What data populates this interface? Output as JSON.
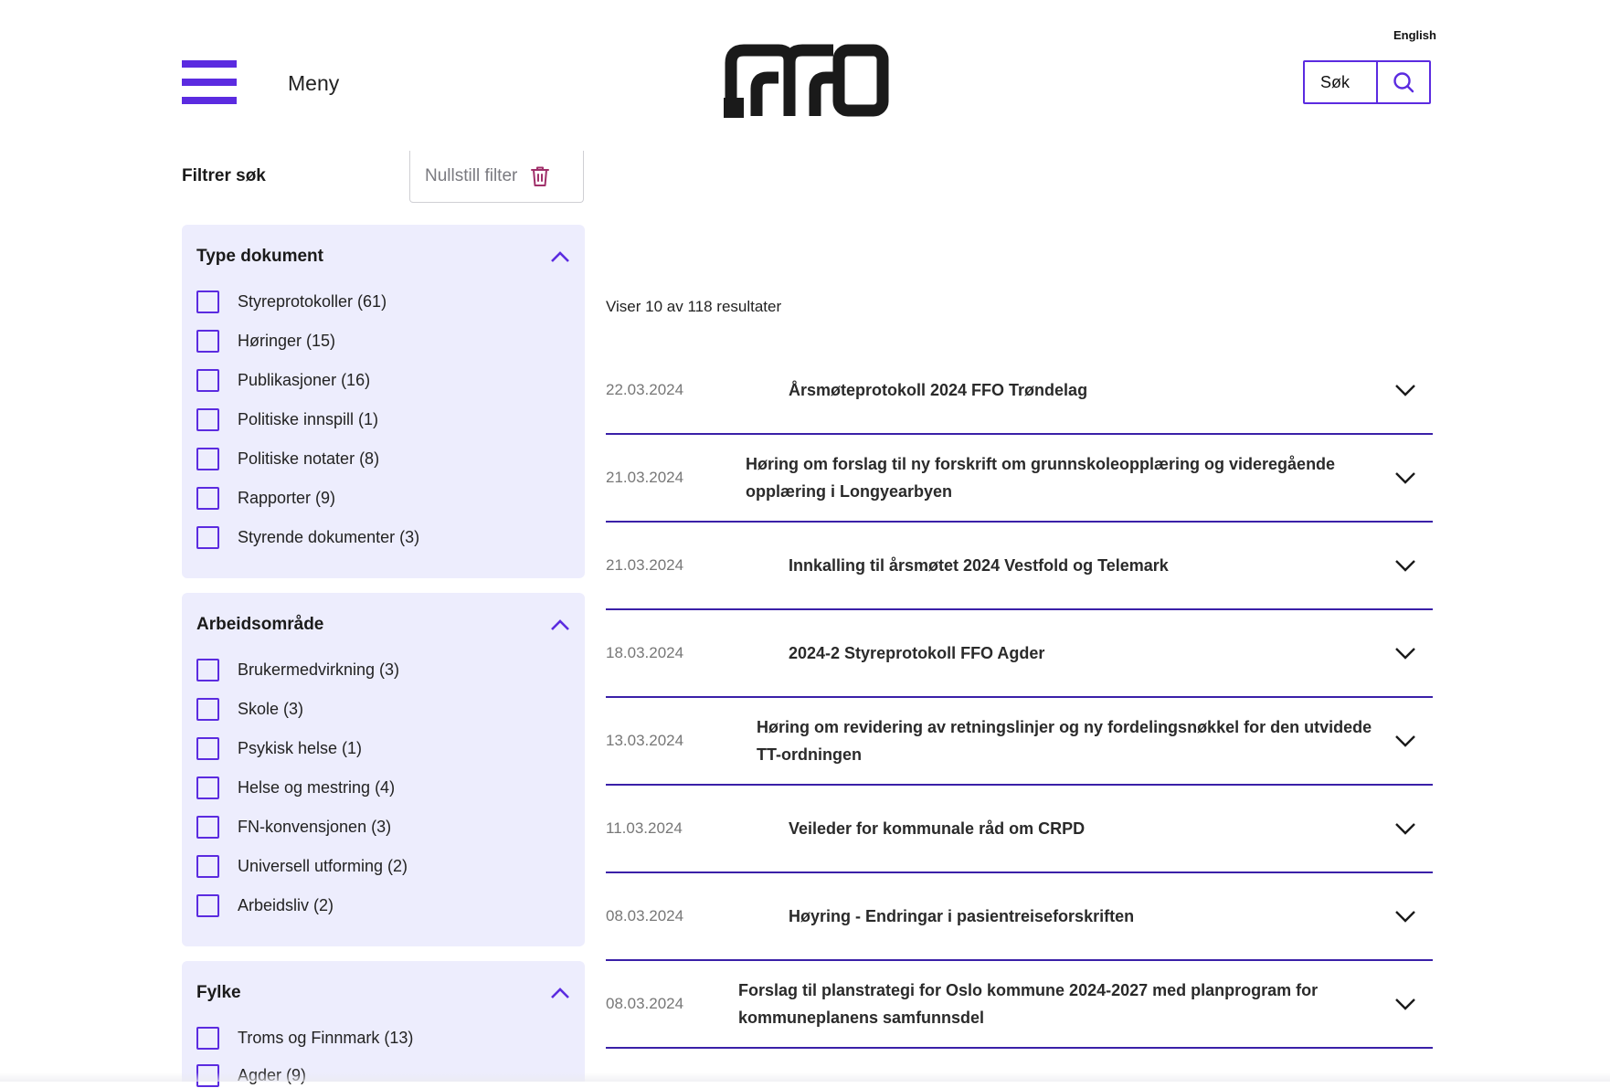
{
  "header": {
    "menu_label": "Meny",
    "logo_text": "FFO",
    "language_link": "English",
    "search_placeholder": "Søk",
    "accent_color": "#5b2be0"
  },
  "filters": {
    "title": "Filtrer søk",
    "reset_label": "Nullstill filter",
    "groups": [
      {
        "title": "Type dokument",
        "expanded": true,
        "options": [
          {
            "label": "Styreprotokoller (61)",
            "checked": false
          },
          {
            "label": "Høringer (15)",
            "checked": false
          },
          {
            "label": "Publikasjoner (16)",
            "checked": false
          },
          {
            "label": "Politiske innspill (1)",
            "checked": false
          },
          {
            "label": "Politiske notater (8)",
            "checked": false
          },
          {
            "label": "Rapporter (9)",
            "checked": false
          },
          {
            "label": "Styrende dokumenter (3)",
            "checked": false
          }
        ]
      },
      {
        "title": "Arbeidsområde",
        "expanded": true,
        "options": [
          {
            "label": "Brukermedvirkning (3)",
            "checked": false
          },
          {
            "label": "Skole (3)",
            "checked": false
          },
          {
            "label": "Psykisk helse (1)",
            "checked": false
          },
          {
            "label": "Helse og mestring (4)",
            "checked": false
          },
          {
            "label": "FN-konvensjonen (3)",
            "checked": false
          },
          {
            "label": "Universell utforming (2)",
            "checked": false
          },
          {
            "label": "Arbeidsliv (2)",
            "checked": false
          }
        ]
      },
      {
        "title": "Fylke",
        "expanded": true,
        "options": [
          {
            "label": "Troms og Finnmark (13)",
            "checked": false
          },
          {
            "label": "Agder (9)",
            "checked": false
          }
        ]
      }
    ]
  },
  "results": {
    "count_text": "Viser 10 av 118 resultater",
    "items": [
      {
        "date": "22.03.2024",
        "title": "Årsmøteprotokoll 2024 FFO Trøndelag"
      },
      {
        "date": "21.03.2024",
        "title": "Høring om forslag til ny forskrift om grunnskoleopplæring og videregående opplæring i Longyearbyen"
      },
      {
        "date": "21.03.2024",
        "title": "Innkalling til årsmøtet 2024 Vestfold og Telemark"
      },
      {
        "date": "18.03.2024",
        "title": "2024-2 Styreprotokoll FFO Agder"
      },
      {
        "date": "13.03.2024",
        "title": "Høring om revidering av retningslinjer og ny fordelingsnøkkel for den utvidede TT-ordningen"
      },
      {
        "date": "11.03.2024",
        "title": "Veileder for kommunale råd om CRPD"
      },
      {
        "date": "08.03.2024",
        "title": "Høyring - Endringar i pasientreiseforskriften"
      },
      {
        "date": "08.03.2024",
        "title": "Forslag til planstrategi for Oslo kommune 2024-2027 med planprogram for kommuneplanens samfunnsdel"
      }
    ]
  }
}
